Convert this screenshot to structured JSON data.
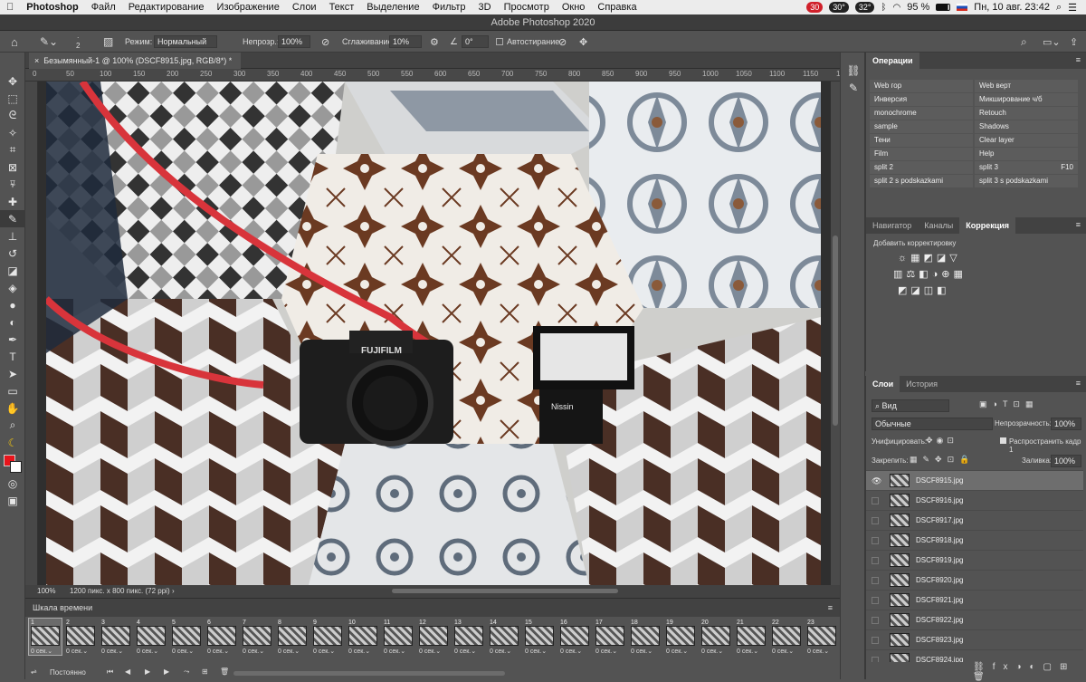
{
  "menubar": {
    "apple": "",
    "items": [
      "Photoshop",
      "Файл",
      "Редактирование",
      "Изображение",
      "Слои",
      "Текст",
      "Выделение",
      "Фильтр",
      "3D",
      "Просмотр",
      "Окно",
      "Справка"
    ],
    "status": {
      "badge1": "30",
      "temp1": "30°",
      "temp2": "32°",
      "battery": "95 %",
      "datetime": "Пн, 10 авг.  23:42"
    }
  },
  "window": {
    "title": "Adobe Photoshop 2020"
  },
  "options": {
    "mode_label": "Режим:",
    "mode_value": "Нормальный",
    "opacity_label": "Непрозр.:",
    "opacity_value": "100%",
    "smooth_label": "Сглаживание:",
    "smooth_value": "10%",
    "angle_value": "0°",
    "autoerase_label": "Автостирание",
    "brush_size": "2"
  },
  "document": {
    "tab_title": "Безымянный-1 @ 100% (DSCF8915.jpg, RGB/8*) *",
    "ruler_ticks": [
      "0",
      "50",
      "100",
      "150",
      "200",
      "250",
      "300",
      "350",
      "400",
      "450",
      "500",
      "550",
      "600",
      "650",
      "700",
      "750",
      "800",
      "850",
      "900",
      "950",
      "1000",
      "1050",
      "1100",
      "1150",
      "120"
    ],
    "zoom": "100%",
    "info": "1200 пикс. x 800 пикс. (72 ppi)"
  },
  "timeline": {
    "title": "Шкала времени",
    "frames": [
      {
        "num": "1",
        "dur": "0 сек.⌄"
      },
      {
        "num": "2",
        "dur": "0 сек.⌄"
      },
      {
        "num": "3",
        "dur": "0 сек.⌄"
      },
      {
        "num": "4",
        "dur": "0 сек.⌄"
      },
      {
        "num": "5",
        "dur": "0 сек.⌄"
      },
      {
        "num": "6",
        "dur": "0 сек.⌄"
      },
      {
        "num": "7",
        "dur": "0 сек.⌄"
      },
      {
        "num": "8",
        "dur": "0 сек.⌄"
      },
      {
        "num": "9",
        "dur": "0 сек.⌄"
      },
      {
        "num": "10",
        "dur": "0 сек.⌄"
      },
      {
        "num": "11",
        "dur": "0 сек.⌄"
      },
      {
        "num": "12",
        "dur": "0 сек.⌄"
      },
      {
        "num": "13",
        "dur": "0 сек.⌄"
      },
      {
        "num": "14",
        "dur": "0 сек.⌄"
      },
      {
        "num": "15",
        "dur": "0 сек.⌄"
      },
      {
        "num": "16",
        "dur": "0 сек.⌄"
      },
      {
        "num": "17",
        "dur": "0 сек.⌄"
      },
      {
        "num": "18",
        "dur": "0 сек.⌄"
      },
      {
        "num": "19",
        "dur": "0 сек.⌄"
      },
      {
        "num": "20",
        "dur": "0 сек.⌄"
      },
      {
        "num": "21",
        "dur": "0 сек.⌄"
      },
      {
        "num": "22",
        "dur": "0 сек.⌄"
      },
      {
        "num": "23",
        "dur": "0 сек.⌄"
      }
    ],
    "loop": "Постоянно"
  },
  "actions": {
    "tab": "Операции",
    "items": [
      {
        "left": "Web гор",
        "right": "Web верт"
      },
      {
        "left": "Инверсия",
        "right": "Микширование ч/б"
      },
      {
        "left": "monochrome",
        "right": "Retouch"
      },
      {
        "left": "sample",
        "right": "Shadows"
      },
      {
        "left": "Тени",
        "right": "Clear layer"
      },
      {
        "left": "Film",
        "right": "Help"
      },
      {
        "left": "split 2",
        "right": "split 3",
        "key": "F10"
      },
      {
        "left": "split 2 s podskazkami",
        "right": "split 3 s podskazkami"
      }
    ]
  },
  "adjustments": {
    "tabs": [
      "Навигатор",
      "Каналы",
      "Коррекция"
    ],
    "add_label": "Добавить корректировку"
  },
  "layers": {
    "tabs": [
      "Слои",
      "История"
    ],
    "filter": "Вид",
    "blend": "Обычные",
    "opacity_label": "Непрозрачность:",
    "opacity_value": "100%",
    "unify_label": "Унифицировать:",
    "propagate_label": "Распространить кадр 1",
    "lock_label": "Закрепить:",
    "fill_label": "Заливка:",
    "fill_value": "100%",
    "rows": [
      "DSCF8915.jpg",
      "DSCF8916.jpg",
      "DSCF8917.jpg",
      "DSCF8918.jpg",
      "DSCF8919.jpg",
      "DSCF8920.jpg",
      "DSCF8921.jpg",
      "DSCF8922.jpg",
      "DSCF8923.jpg",
      "DSCF8924.jpg"
    ]
  },
  "colors": {
    "foreground": "#e8141b",
    "background": "#ffffff",
    "strap": "#d8343b"
  }
}
